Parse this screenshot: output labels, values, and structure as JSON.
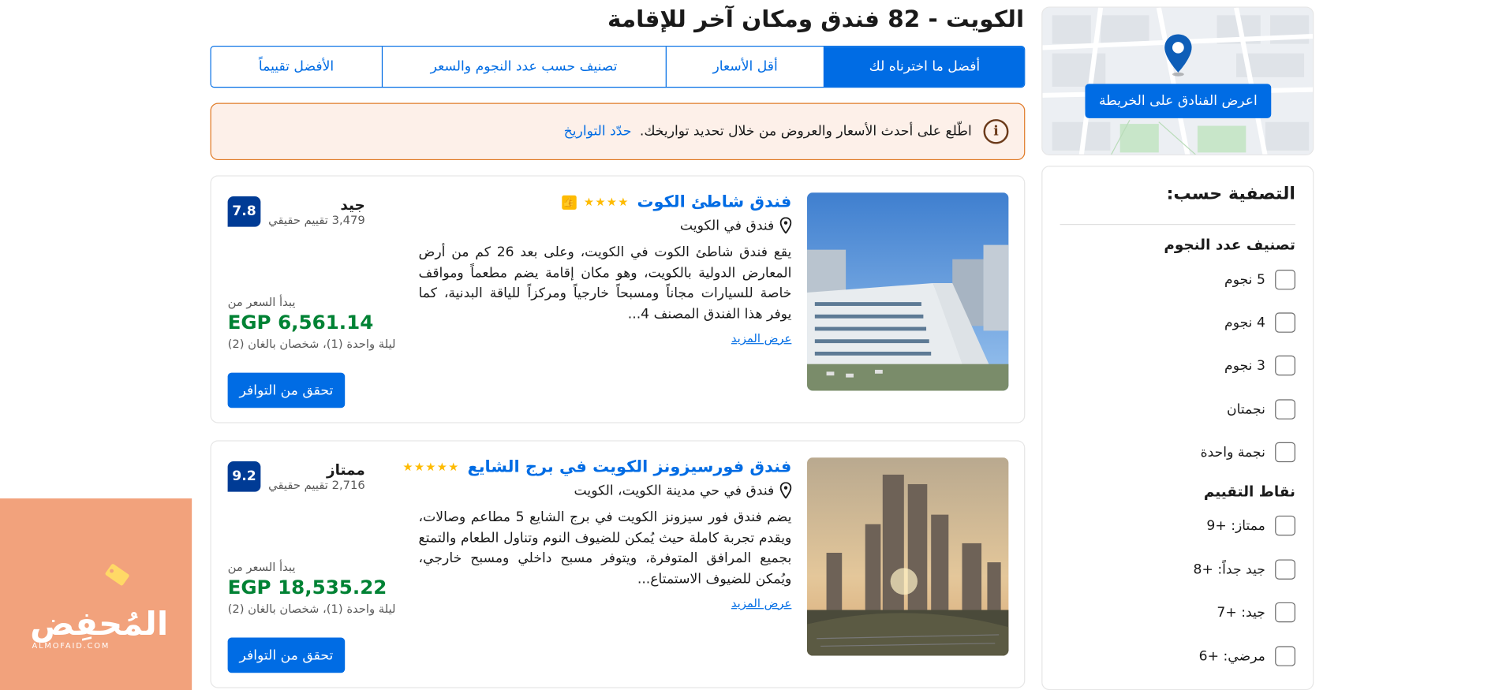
{
  "page_title": "الكويت - 82 فندق ومكان آخر للإقامة",
  "sort_tabs": [
    {
      "label": "أفضل ما اخترناه لك",
      "active": true
    },
    {
      "label": "أقل الأسعار",
      "active": false
    },
    {
      "label": "تصنيف حسب عدد النجوم والسعر",
      "active": false
    },
    {
      "label": "الأفضل تقييماً",
      "active": false
    }
  ],
  "info_banner": {
    "icon": "info-icon",
    "text": "اطّلع على أحدث الأسعار والعروض من خلال تحديد تواريخك.",
    "link": "حدّد التواريخ",
    "bg_color": "#fdf0e9",
    "border_color": "#e07b28"
  },
  "map": {
    "button_label": "اعرض الفنادق على الخريطة",
    "pin_icon": "map-pin-icon"
  },
  "filters": {
    "title": "التصفية حسب:",
    "star_rating": {
      "heading": "تصنيف عدد النجوم",
      "options": [
        "5 نجوم",
        "4 نجوم",
        "3 نجوم",
        "نجمتان",
        "نجمة واحدة"
      ]
    },
    "review_score": {
      "heading": "نقاط التقييم",
      "options": [
        "ممتاز: +9",
        "جيد جداً: +8",
        "جيد: +7",
        "مرضي: +6"
      ]
    }
  },
  "hotels": [
    {
      "name": "فندق شاطئ الكوت",
      "stars": 4,
      "stars_text": "★★★★",
      "has_badge": true,
      "location": "فندق في الكويت",
      "description": "يقع فندق شاطئ الكوت في الكويت، وعلى بعد 26 كم من أرض المعارض الدولية بالكويت، وهو مكان إقامة يضم مطعماً ومواقف خاصة للسيارات مجاناً ومسبحاً خارجياً ومركزاً للياقة البدنية، كما يوفر هذا الفندق المصنف 4...",
      "more_label": "عرض المزيد",
      "rating_word": "جيد",
      "review_count": "3,479 تقييم حقيقي",
      "score": "7.8",
      "price_from": "يبدأ السعر من",
      "price": "EGP 6,561.14",
      "price_note": "ليلة واحدة (1)، شخصان بالغان (2)",
      "button_label": "تحقق من التوافر"
    },
    {
      "name": "فندق فورسيزونز الكويت في برج الشايع",
      "stars": 5,
      "stars_text": "★★★★★",
      "has_badge": false,
      "location": "فندق في حي مدينة الكويت، الكويت",
      "description": "يضم فندق فور سيزونز الكويت في برج الشايع 5 مطاعم وصالات، ويقدم تجربة كاملة حيث يُمكن للضيوف النوم وتناول الطعام والتمتع بجميع المرافق المتوفرة، ويتوفر مسبح داخلي ومسبح خارجي، ويُمكن للضيوف الاستمتاع...",
      "more_label": "عرض المزيد",
      "rating_word": "ممتاز",
      "review_count": "2,716 تقييم حقيقي",
      "score": "9.2",
      "price_from": "يبدأ السعر من",
      "price": "EGP 18,535.22",
      "price_note": "ليلة واحدة (1)، شخصان بالغان (2)",
      "button_label": "تحقق من التوافر"
    }
  ],
  "brand": {
    "name": "المُحفِض",
    "domain": "ALMOFAID.COM",
    "bg_color": "#f2a27c"
  },
  "colors": {
    "primary": "#006ce4",
    "score": "#003b95",
    "price": "#008234",
    "star": "#febb02"
  }
}
